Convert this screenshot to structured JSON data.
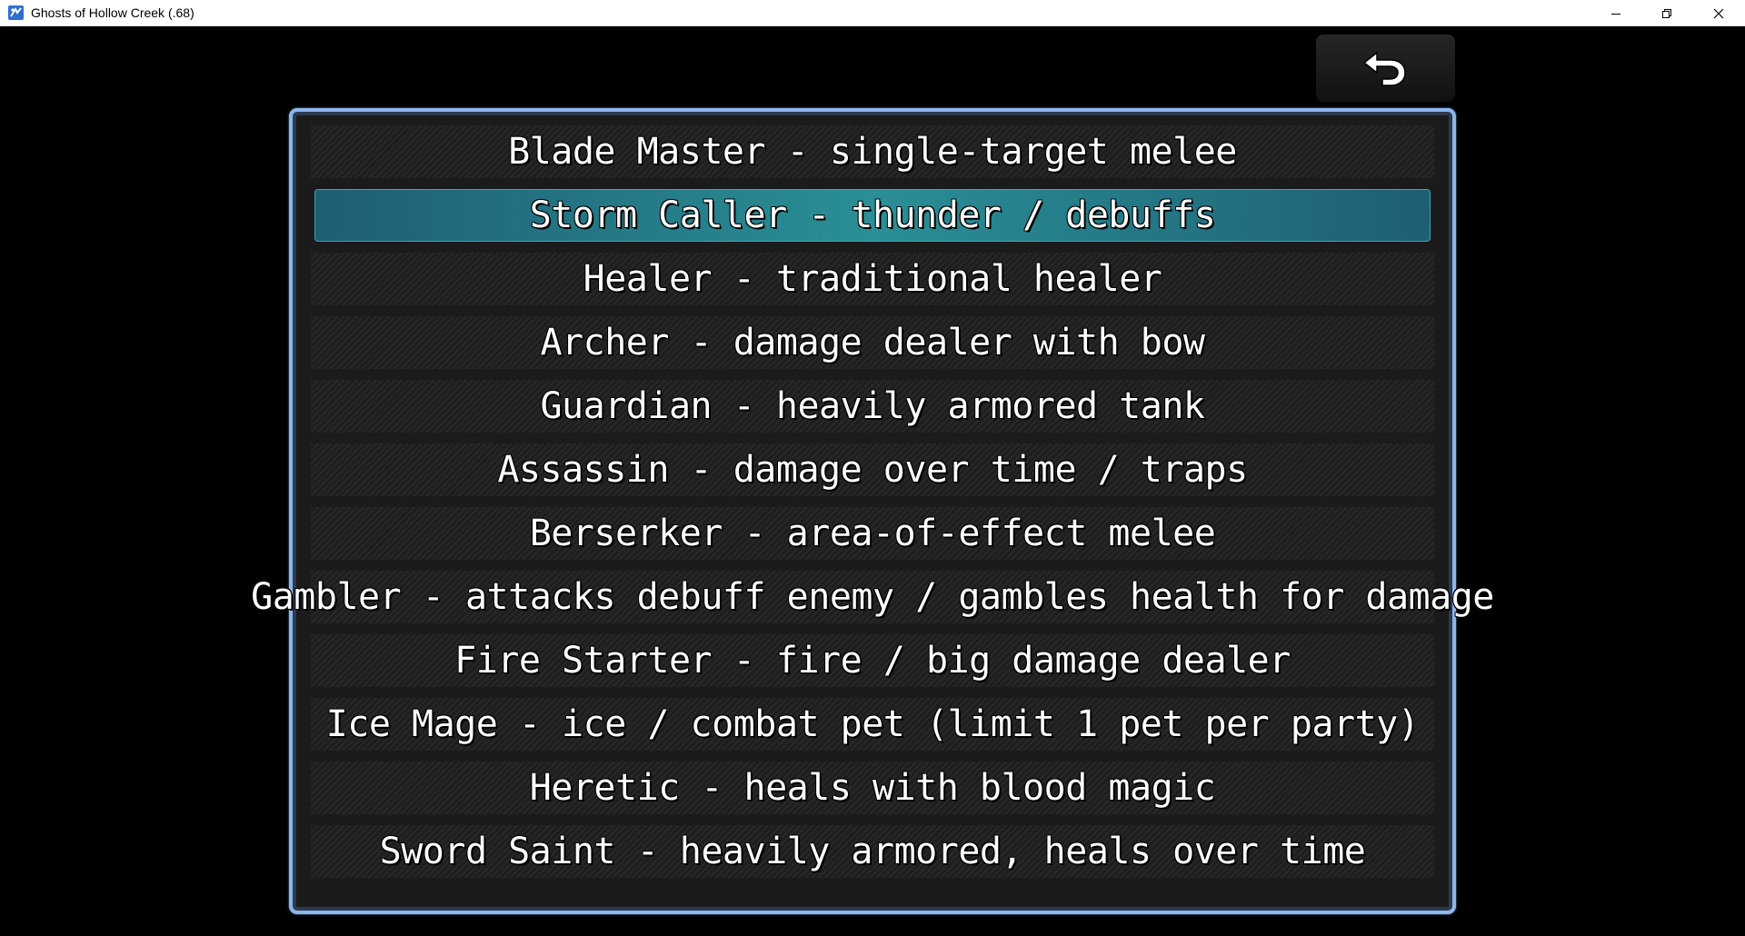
{
  "window": {
    "title": "Ghosts of Hollow Creek (.68)",
    "controls": {
      "minimize": "minimize-icon",
      "maximize": "restore-icon",
      "close": "close-icon"
    }
  },
  "back_button": {
    "icon": "back-arrow-icon"
  },
  "class_menu": {
    "selected_index": 1,
    "accent_color": "#8db6ec",
    "selected_color": "#24808c",
    "items": [
      {
        "label": "Blade Master - single-target melee"
      },
      {
        "label": "Storm Caller - thunder / debuffs"
      },
      {
        "label": "Healer - traditional healer"
      },
      {
        "label": "Archer - damage dealer with bow"
      },
      {
        "label": "Guardian - heavily armored tank"
      },
      {
        "label": "Assassin - damage over time / traps"
      },
      {
        "label": "Berserker - area-of-effect melee"
      },
      {
        "label": "Gambler - attacks debuff enemy / gambles health for damage"
      },
      {
        "label": "Fire Starter - fire / big damage dealer"
      },
      {
        "label": "Ice Mage - ice / combat pet (limit 1 pet per party)"
      },
      {
        "label": "Heretic - heals with blood magic"
      },
      {
        "label": "Sword Saint - heavily armored, heals over time"
      }
    ]
  }
}
